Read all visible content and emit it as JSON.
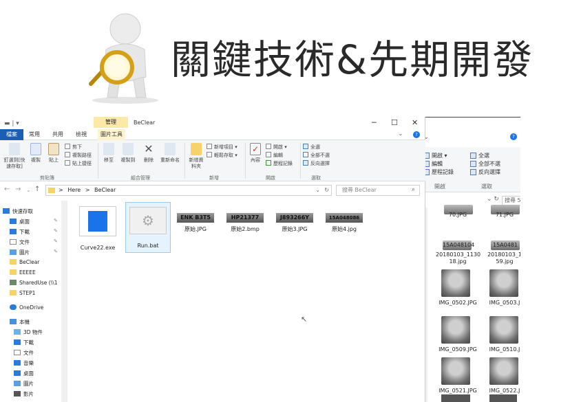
{
  "slide": {
    "title": "關鍵技術&先期開發"
  },
  "explorer": {
    "quick_access_toolbar": "▬ | ▾",
    "context_tab": "管理",
    "window_title": "BeClear",
    "controls": {
      "minimize": "─",
      "maximize": "☐",
      "close": "✕"
    },
    "tabs": [
      "檔案",
      "常用",
      "共用",
      "檢視",
      "圖片工具"
    ],
    "ribbon": {
      "clipboard": {
        "pin_label": "釘選到[快速存取]",
        "copy": "複製",
        "paste": "貼上",
        "cut": "剪下",
        "copy_path": "複製路徑",
        "paste_shortcut": "貼上捷徑",
        "group": "剪貼簿"
      },
      "organize": {
        "move_to": "移至",
        "copy_to": "複製到",
        "delete": "刪除",
        "rename": "重新命名",
        "group": "組合管理"
      },
      "new": {
        "new_folder": "新增資料夾",
        "new_item": "新增項目 ▾",
        "easy_access": "輕鬆存取 ▾",
        "group": "新增"
      },
      "open": {
        "properties": "內容",
        "open": "開啟 ▾",
        "edit": "編輯",
        "history": "歷程記錄",
        "group": "開啟"
      },
      "select": {
        "select_all": "全選",
        "select_none": "全部不選",
        "invert": "反向選擇",
        "group": "選取"
      }
    },
    "address": {
      "crumb_root": "Here",
      "crumb_sep": ">",
      "crumb_folder": "BeClear",
      "search_placeholder": "搜尋 BeClear"
    },
    "nav_pane": {
      "quick_access": "快速存取",
      "items": [
        "桌面",
        "下載",
        "文件",
        "圖片",
        "BeClear",
        "EEEEE",
        "SharedUse (\\\\1",
        "STEP1"
      ],
      "onedrive": "OneDrive",
      "this_pc": "本機",
      "pc_items": [
        "3D 物件",
        "下載",
        "文件",
        "音樂",
        "桌面",
        "圖片",
        "影片"
      ]
    },
    "files": [
      {
        "name": "Curve22.exe",
        "plate": ""
      },
      {
        "name": "Run.bat",
        "plate": ""
      },
      {
        "name": "原始.JPG",
        "plate": "ENK B3T5"
      },
      {
        "name": "原始2.bmp",
        "plate": "HP21377"
      },
      {
        "name": "原始3.JPG",
        "plate": "J893266Y"
      },
      {
        "name": "原始4.jpg",
        "plate": "15A048086"
      }
    ]
  },
  "back_window": {
    "ribbon": {
      "open": "開啟 ▾",
      "edit": "編輯",
      "history": "歷程記錄",
      "select_all": "全選",
      "select_none": "全部不選",
      "invert": "反向選擇",
      "group_open": "開啟",
      "group_select": "選取"
    },
    "search": "搜尋 5",
    "files": [
      {
        "name": "70.JPG"
      },
      {
        "name": "71.JPG"
      },
      {
        "name": "20180103_113018.jpg",
        "line1": "20180103_1130",
        "line2": "18.jpg",
        "plate": "15A048104"
      },
      {
        "name": "20180103_1…59.jpg",
        "line1": "20180103_1",
        "line2": "59.jpg",
        "plate": "15A0481"
      },
      {
        "name": "IMG_0502.JPG"
      },
      {
        "name": "IMG_0503.J"
      },
      {
        "name": "IMG_0509.JPG"
      },
      {
        "name": "IMG_0510.J"
      },
      {
        "name": "IMG_0521.JPG"
      },
      {
        "name": "IMG_0522.J"
      }
    ],
    "edge_fragments": [
      "42",
      "G",
      "G",
      "G"
    ]
  }
}
